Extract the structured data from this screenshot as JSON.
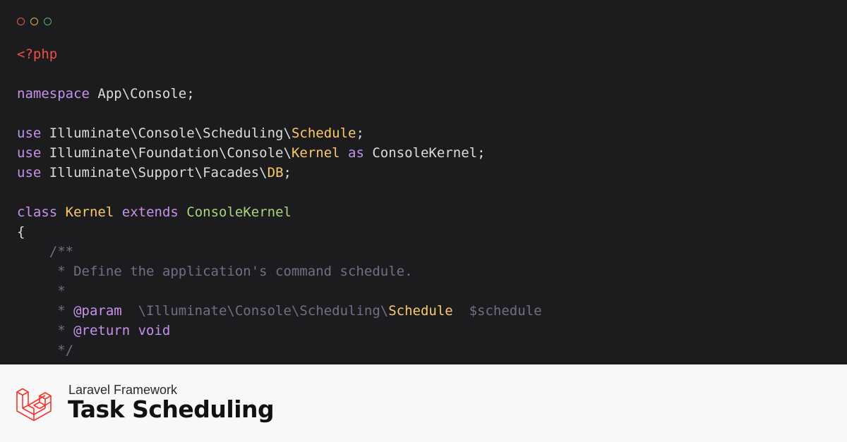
{
  "window": {
    "controls": [
      "close",
      "minimize",
      "maximize"
    ],
    "colors": {
      "close": "#e25f4f",
      "minimize": "#d8b84c",
      "maximize": "#58b765"
    }
  },
  "code": {
    "lines": [
      [
        {
          "t": "<?php",
          "c": "tag"
        }
      ],
      [],
      [
        {
          "t": "namespace",
          "c": "kw"
        },
        {
          "t": " App\\Console;",
          "c": "plain"
        }
      ],
      [],
      [
        {
          "t": "use",
          "c": "kw"
        },
        {
          "t": " Illuminate\\Console\\Scheduling\\",
          "c": "plain"
        },
        {
          "t": "Schedule",
          "c": "cls"
        },
        {
          "t": ";",
          "c": "plain"
        }
      ],
      [
        {
          "t": "use",
          "c": "kw"
        },
        {
          "t": " Illuminate\\Foundation\\Console\\",
          "c": "plain"
        },
        {
          "t": "Kernel",
          "c": "cls"
        },
        {
          "t": " ",
          "c": "plain"
        },
        {
          "t": "as",
          "c": "kw"
        },
        {
          "t": " ConsoleKernel;",
          "c": "plain"
        }
      ],
      [
        {
          "t": "use",
          "c": "kw"
        },
        {
          "t": " Illuminate\\Support\\Facades\\",
          "c": "plain"
        },
        {
          "t": "DB",
          "c": "cls"
        },
        {
          "t": ";",
          "c": "plain"
        }
      ],
      [],
      [
        {
          "t": "class",
          "c": "kw"
        },
        {
          "t": " ",
          "c": "plain"
        },
        {
          "t": "Kernel",
          "c": "cls"
        },
        {
          "t": " ",
          "c": "plain"
        },
        {
          "t": "extends",
          "c": "kw"
        },
        {
          "t": " ",
          "c": "plain"
        },
        {
          "t": "ConsoleKernel",
          "c": "ext"
        }
      ],
      [
        {
          "t": "{",
          "c": "plain"
        }
      ],
      [
        {
          "t": "    /**",
          "c": "cmt"
        }
      ],
      [
        {
          "t": "     * Define the application's command schedule.",
          "c": "cmt"
        }
      ],
      [
        {
          "t": "     *",
          "c": "cmt"
        }
      ],
      [
        {
          "t": "     * ",
          "c": "cmt"
        },
        {
          "t": "@param",
          "c": "doc"
        },
        {
          "t": "  \\Illuminate\\Console\\Scheduling\\",
          "c": "cmt"
        },
        {
          "t": "Schedule",
          "c": "cls"
        },
        {
          "t": "  $schedule",
          "c": "cmt"
        }
      ],
      [
        {
          "t": "     * ",
          "c": "cmt"
        },
        {
          "t": "@return",
          "c": "doc"
        },
        {
          "t": " ",
          "c": "cmt"
        },
        {
          "t": "void",
          "c": "doc"
        }
      ],
      [
        {
          "t": "     */",
          "c": "cmt"
        }
      ]
    ]
  },
  "footer": {
    "logo_icon": "laravel-logo-icon",
    "logo_color": "#f9322c",
    "subtitle": "Laravel Framework",
    "title": "Task Scheduling"
  }
}
